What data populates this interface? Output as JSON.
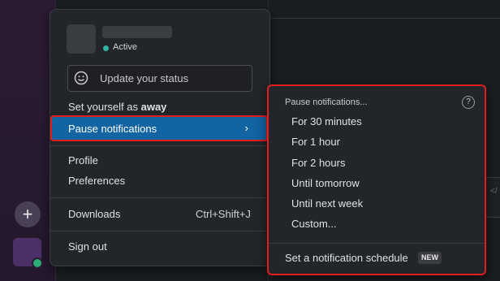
{
  "profile": {
    "status": "Active",
    "update_status_placeholder": "Update your status"
  },
  "menu": {
    "set_away_prefix": "Set yourself as ",
    "set_away_bold": "away",
    "pause_notifications": "Pause notifications",
    "chevron": "›",
    "profile": "Profile",
    "preferences": "Preferences",
    "downloads": "Downloads",
    "downloads_shortcut": "Ctrl+Shift+J",
    "sign_out": "Sign out"
  },
  "submenu": {
    "heading": "Pause notifications...",
    "help_glyph": "?",
    "items": [
      "For 30 minutes",
      "For 1 hour",
      "For 2 hours",
      "Until tomorrow",
      "Until next week",
      "Custom..."
    ],
    "schedule": "Set a notification schedule",
    "new_badge": "NEW"
  },
  "rail": {
    "add_glyph": "+"
  },
  "colors": {
    "highlight": "#1264a3",
    "annotation_red": "#e01e1e",
    "active_dot": "#2eb5a2"
  },
  "icons": [
    "smiley-icon",
    "chevron-right-icon",
    "help-icon",
    "plus-icon"
  ]
}
